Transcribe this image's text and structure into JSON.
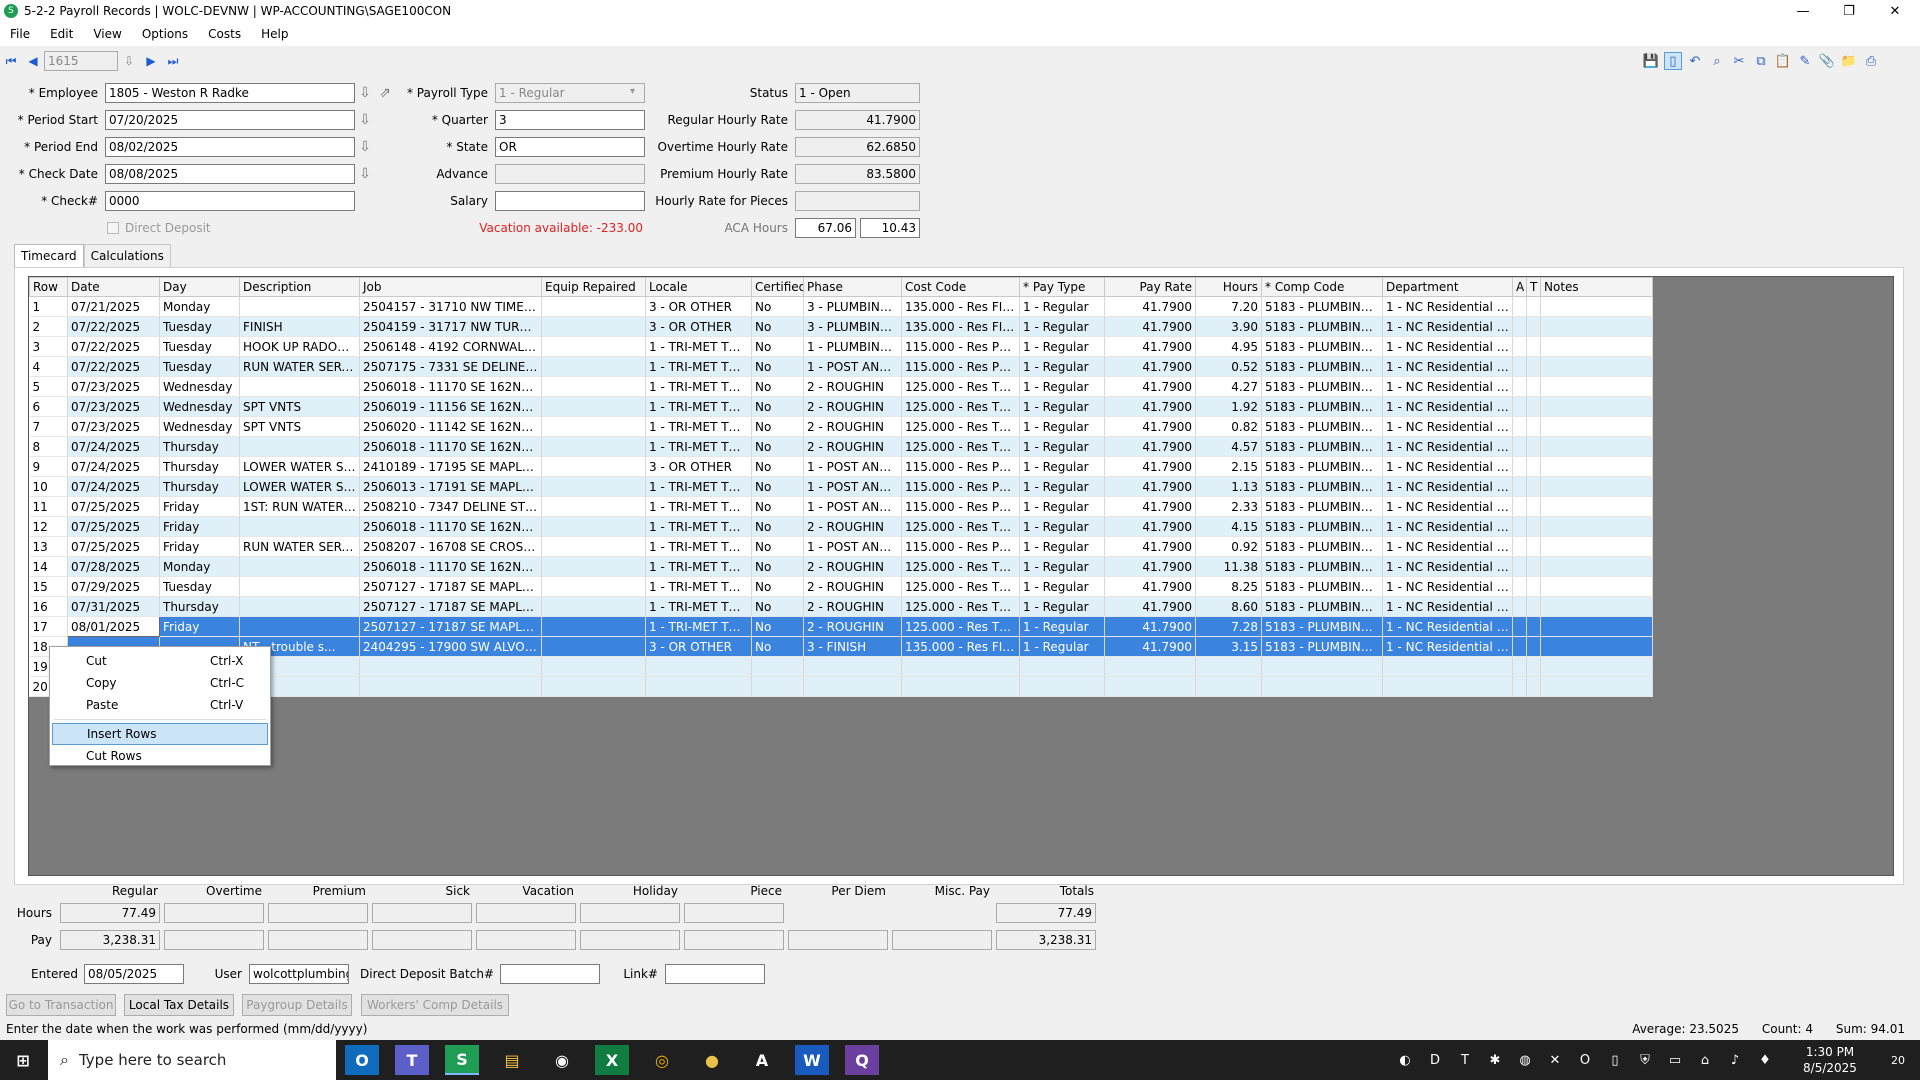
{
  "window": {
    "title": "5-2-2 Payroll Records | WOLC-DEVNW | WP-ACCOUNTING\\SAGE100CON",
    "min": "—",
    "restore": "❐",
    "close": "✕"
  },
  "menu": [
    "File",
    "Edit",
    "View",
    "Options",
    "Costs",
    "Help"
  ],
  "nav": {
    "record": "1615"
  },
  "form": {
    "employee_label": "* Employee",
    "employee": "1805 - Weston R Radke",
    "period_start_label": "* Period Start",
    "period_start": "07/20/2025",
    "period_end_label": "* Period End",
    "period_end": "08/02/2025",
    "check_date_label": "* Check Date",
    "check_date": "08/08/2025",
    "check_no_label": "* Check#",
    "check_no": "0000",
    "direct_deposit_label": "Direct Deposit",
    "payroll_type_label": "* Payroll Type",
    "payroll_type": "1 - Regular",
    "quarter_label": "* Quarter",
    "quarter": "3",
    "state_label": "* State",
    "state": "OR",
    "advance_label": "Advance",
    "advance": "",
    "salary_label": "Salary",
    "salary": "",
    "vacation_available": "Vacation available:  -233.00",
    "status_label": "Status",
    "status": "1 - Open",
    "regular_rate_label": "Regular Hourly Rate",
    "regular_rate": "41.7900",
    "overtime_rate_label": "Overtime Hourly Rate",
    "overtime_rate": "62.6850",
    "premium_rate_label": "Premium Hourly Rate",
    "premium_rate": "83.5800",
    "pieces_rate_label": "Hourly Rate for Pieces",
    "pieces_rate": "",
    "aca_label": "ACA Hours",
    "aca_1": "67.06",
    "aca_2": "10.43"
  },
  "tabs": [
    "Timecard",
    "Calculations"
  ],
  "grid": {
    "columns": [
      "Row",
      "Date",
      "Day",
      "Description",
      "Job",
      "Equip Repaired",
      "Locale",
      "Certified",
      "Phase",
      "Cost Code",
      "* Pay Type",
      "Pay Rate",
      "Hours",
      "* Comp Code",
      "Department",
      "A",
      "T",
      "Notes"
    ],
    "rows": [
      [
        "1",
        "07/21/2025",
        "Monday",
        "",
        "2504157 - 31710 NW TIMERIC...",
        "",
        "3 - OR OTHER",
        "No",
        "3 - PLUMBING...",
        "135.000 - Res FIN...",
        "1 - Regular",
        "41.7900",
        "7.20",
        "5183 - PLUMBING...",
        "1 - NC Residential Pl...",
        "",
        "",
        ""
      ],
      [
        "2",
        "07/22/2025",
        "Tuesday",
        "FINISH",
        "2504159 - 31717 NW TUREL D...",
        "",
        "3 - OR OTHER",
        "No",
        "3 - PLUMBING...",
        "135.000 - Res FIN...",
        "1 - Regular",
        "41.7900",
        "3.90",
        "5183 - PLUMBING...",
        "1 - NC Residential Pl...",
        "",
        "",
        ""
      ],
      [
        "3",
        "07/22/2025",
        "Tuesday",
        "HOOK UP RADON...",
        "2506148 - 4192 CORNWALL ST...",
        "",
        "1 - TRI-MET TRA...",
        "No",
        "1 - PLUMBING...",
        "115.000 - Res P&B...",
        "1 - Regular",
        "41.7900",
        "4.95",
        "5183 - PLUMBING...",
        "1 - NC Residential Pl...",
        "",
        "",
        ""
      ],
      [
        "4",
        "07/22/2025",
        "Tuesday",
        "RUN WATER SERVIC...",
        "2507175 - 7331 SE DELINE ST B...",
        "",
        "1 - TRI-MET TRA...",
        "No",
        "1 - POST AND...",
        "115.000 - Res P&B...",
        "1 - Regular",
        "41.7900",
        "0.52",
        "5183 - PLUMBING...",
        "1 - NC Residential Pl...",
        "",
        "",
        ""
      ],
      [
        "5",
        "07/23/2025",
        "Wednesday",
        "",
        "2506018 - 11170 SE 162ND AV...",
        "",
        "1 - TRI-MET TRA...",
        "No",
        "2 - ROUGHIN",
        "125.000 - Res TO A...",
        "1 - Regular",
        "41.7900",
        "4.27",
        "5183 - PLUMBING...",
        "1 - NC Residential Pl...",
        "",
        "",
        ""
      ],
      [
        "6",
        "07/23/2025",
        "Wednesday",
        "SPT VNTS",
        "2506019 - 11156 SE 162ND AV...",
        "",
        "1 - TRI-MET TRA...",
        "No",
        "2 - ROUGHIN",
        "125.000 - Res TO A...",
        "1 - Regular",
        "41.7900",
        "1.92",
        "5183 - PLUMBING...",
        "1 - NC Residential Pl...",
        "",
        "",
        ""
      ],
      [
        "7",
        "07/23/2025",
        "Wednesday",
        "SPT VNTS",
        "2506020 - 11142 SE 162ND AV...",
        "",
        "1 - TRI-MET TRA...",
        "No",
        "2 - ROUGHIN",
        "125.000 - Res TO A...",
        "1 - Regular",
        "41.7900",
        "0.82",
        "5183 - PLUMBING...",
        "1 - NC Residential Pl...",
        "",
        "",
        ""
      ],
      [
        "8",
        "07/24/2025",
        "Thursday",
        "",
        "2506018 - 11170 SE 162ND AV...",
        "",
        "1 - TRI-MET TRA...",
        "No",
        "2 - ROUGHIN",
        "125.000 - Res TO A...",
        "1 - Regular",
        "41.7900",
        "4.57",
        "5183 - PLUMBING...",
        "1 - NC Residential Pl...",
        "",
        "",
        ""
      ],
      [
        "9",
        "07/24/2025",
        "Thursday",
        "LOWER WATER SER...",
        "2410189 - 17195 SE MAPLE HIL...",
        "",
        "3 - OR OTHER",
        "No",
        "1 - POST AND...",
        "115.000 - Res P&B...",
        "1 - Regular",
        "41.7900",
        "2.15",
        "5183 - PLUMBING...",
        "1 - NC Residential Pl...",
        "",
        "",
        ""
      ],
      [
        "10",
        "07/24/2025",
        "Thursday",
        "LOWER WATER SER...",
        "2506013 - 17191 SE MAPLE HIL...",
        "",
        "1 - TRI-MET TRA...",
        "No",
        "1 - POST AND...",
        "115.000 - Res P&B...",
        "1 - Regular",
        "41.7900",
        "1.13",
        "5183 - PLUMBING...",
        "1 - NC Residential Pl...",
        "",
        "",
        ""
      ],
      [
        "11",
        "07/25/2025",
        "Friday",
        "1ST: RUN WATER SE...",
        "2508210 - 7347 DELINE ST BN5...",
        "",
        "1 - TRI-MET TRA...",
        "No",
        "1 - POST AND...",
        "115.000 - Res P&B...",
        "1 - Regular",
        "41.7900",
        "2.33",
        "5183 - PLUMBING...",
        "1 - NC Residential Pl...",
        "",
        "",
        ""
      ],
      [
        "12",
        "07/25/2025",
        "Friday",
        "",
        "2506018 - 11170 SE 162ND AV...",
        "",
        "1 - TRI-MET TRA...",
        "No",
        "2 - ROUGHIN",
        "125.000 - Res TO A...",
        "1 - Regular",
        "41.7900",
        "4.15",
        "5183 - PLUMBING...",
        "1 - NC Residential Pl...",
        "",
        "",
        ""
      ],
      [
        "13",
        "07/25/2025",
        "Friday",
        "RUN WATER SERVICE",
        "2508207 - 16708 SE CROSSLA...",
        "",
        "1 - TRI-MET TRA...",
        "No",
        "1 - POST AND...",
        "115.000 - Res P&B...",
        "1 - Regular",
        "41.7900",
        "0.92",
        "5183 - PLUMBING...",
        "1 - NC Residential Pl...",
        "",
        "",
        ""
      ],
      [
        "14",
        "07/28/2025",
        "Monday",
        "",
        "2506018 - 11170 SE 162ND AV...",
        "",
        "1 - TRI-MET TRA...",
        "No",
        "2 - ROUGHIN",
        "125.000 - Res TO A...",
        "1 - Regular",
        "41.7900",
        "11.38",
        "5183 - PLUMBING...",
        "1 - NC Residential Pl...",
        "",
        "",
        ""
      ],
      [
        "15",
        "07/29/2025",
        "Tuesday",
        "",
        "2507127 - 17187 SE MAPLE HIL...",
        "",
        "1 - TRI-MET TRA...",
        "No",
        "2 - ROUGHIN",
        "125.000 - Res TO A...",
        "1 - Regular",
        "41.7900",
        "8.25",
        "5183 - PLUMBING...",
        "1 - NC Residential Pl...",
        "",
        "",
        ""
      ],
      [
        "16",
        "07/31/2025",
        "Thursday",
        "",
        "2507127 - 17187 SE MAPLE HIL...",
        "",
        "1 - TRI-MET TRA...",
        "No",
        "2 - ROUGHIN",
        "125.000 - Res TO A...",
        "1 - Regular",
        "41.7900",
        "8.60",
        "5183 - PLUMBING...",
        "1 - NC Residential Pl...",
        "",
        "",
        ""
      ],
      [
        "17",
        "08/01/2025",
        "Friday",
        "",
        "2507127 - 17187 SE MAPLE HIL...",
        "",
        "1 - TRI-MET TRA...",
        "No",
        "2 - ROUGHIN",
        "125.000 - Res TO A...",
        "1 - Regular",
        "41.7900",
        "7.28",
        "5183 - PLUMBING...",
        "1 - NC Residential Pl...",
        "",
        "",
        ""
      ],
      [
        "18",
        "",
        "",
        "NT - trouble s...",
        "2404295 - 17900 SW ALVORD...",
        "",
        "3 - OR OTHER",
        "No",
        "3 - FINISH",
        "135.000 - Res FIN...",
        "1 - Regular",
        "41.7900",
        "3.15",
        "5183 - PLUMBING...",
        "1 - NC Residential Pl...",
        "",
        "",
        ""
      ],
      [
        "19",
        "",
        "",
        "",
        "",
        "",
        "",
        "",
        "",
        "",
        "",
        "",
        "",
        "",
        "",
        "",
        "",
        ""
      ],
      [
        "20",
        "",
        "",
        "",
        "",
        "",
        "",
        "",
        "",
        "",
        "",
        "",
        "",
        "",
        "",
        "",
        "",
        ""
      ]
    ]
  },
  "context_menu": [
    {
      "label": "Cut",
      "shortcut": "Ctrl-X"
    },
    {
      "label": "Copy",
      "shortcut": "Ctrl-C"
    },
    {
      "label": "Paste",
      "shortcut": "Ctrl-V"
    },
    {
      "label": "Insert Rows",
      "shortcut": ""
    },
    {
      "label": "Cut Rows",
      "shortcut": ""
    }
  ],
  "totals": {
    "headers": [
      "Regular",
      "Overtime",
      "Premium",
      "Sick",
      "Vacation",
      "Holiday",
      "Piece",
      "Per Diem",
      "Misc. Pay",
      "Totals"
    ],
    "hours_label": "Hours",
    "pay_label": "Pay",
    "hours": [
      "77.49",
      "",
      "",
      "",
      "",
      "",
      "",
      "77.49"
    ],
    "pay": [
      "3,238.31",
      "",
      "",
      "",
      "",
      "",
      "",
      "",
      "",
      "3,238.31"
    ]
  },
  "footer": {
    "entered_label": "Entered",
    "entered": "08/05/2025",
    "user_label": "User",
    "user": "wolcottplumbing\\",
    "ddb_label": "Direct Deposit Batch#",
    "ddb": "",
    "link_label": "Link#",
    "link": ""
  },
  "buttons": {
    "goto": "Go to Transaction",
    "localtax": "Local Tax Details",
    "paygroup": "Paygroup Details",
    "wc": "Workers' Comp Details"
  },
  "status": {
    "hint": "Enter the date when the work was performed (mm/dd/yyyy)",
    "summary": "Average: 23.5025      Count: 4      Sum: 94.01"
  },
  "taskbar": {
    "search": "Type here to search",
    "time": "1:30 PM",
    "date": "8/5/2025",
    "notif": "20"
  }
}
